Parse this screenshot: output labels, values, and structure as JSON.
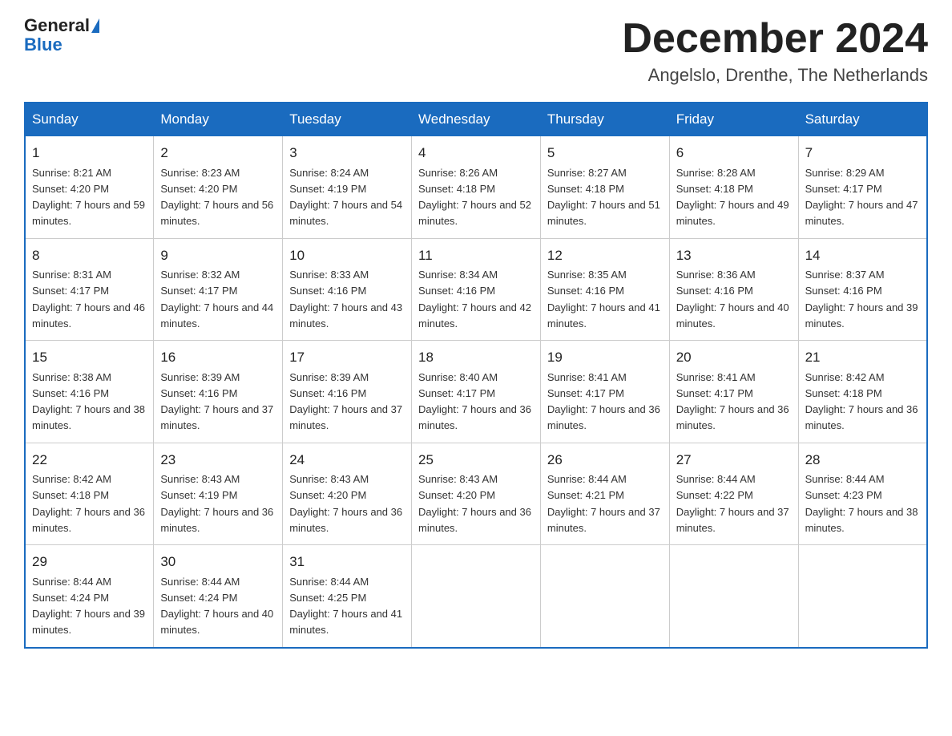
{
  "header": {
    "logo_general": "General",
    "logo_blue": "Blue",
    "title": "December 2024",
    "subtitle": "Angelslo, Drenthe, The Netherlands"
  },
  "days_of_week": [
    "Sunday",
    "Monday",
    "Tuesday",
    "Wednesday",
    "Thursday",
    "Friday",
    "Saturday"
  ],
  "weeks": [
    [
      {
        "date": "1",
        "sunrise": "8:21 AM",
        "sunset": "4:20 PM",
        "daylight": "7 hours and 59 minutes."
      },
      {
        "date": "2",
        "sunrise": "8:23 AM",
        "sunset": "4:20 PM",
        "daylight": "7 hours and 56 minutes."
      },
      {
        "date": "3",
        "sunrise": "8:24 AM",
        "sunset": "4:19 PM",
        "daylight": "7 hours and 54 minutes."
      },
      {
        "date": "4",
        "sunrise": "8:26 AM",
        "sunset": "4:18 PM",
        "daylight": "7 hours and 52 minutes."
      },
      {
        "date": "5",
        "sunrise": "8:27 AM",
        "sunset": "4:18 PM",
        "daylight": "7 hours and 51 minutes."
      },
      {
        "date": "6",
        "sunrise": "8:28 AM",
        "sunset": "4:18 PM",
        "daylight": "7 hours and 49 minutes."
      },
      {
        "date": "7",
        "sunrise": "8:29 AM",
        "sunset": "4:17 PM",
        "daylight": "7 hours and 47 minutes."
      }
    ],
    [
      {
        "date": "8",
        "sunrise": "8:31 AM",
        "sunset": "4:17 PM",
        "daylight": "7 hours and 46 minutes."
      },
      {
        "date": "9",
        "sunrise": "8:32 AM",
        "sunset": "4:17 PM",
        "daylight": "7 hours and 44 minutes."
      },
      {
        "date": "10",
        "sunrise": "8:33 AM",
        "sunset": "4:16 PM",
        "daylight": "7 hours and 43 minutes."
      },
      {
        "date": "11",
        "sunrise": "8:34 AM",
        "sunset": "4:16 PM",
        "daylight": "7 hours and 42 minutes."
      },
      {
        "date": "12",
        "sunrise": "8:35 AM",
        "sunset": "4:16 PM",
        "daylight": "7 hours and 41 minutes."
      },
      {
        "date": "13",
        "sunrise": "8:36 AM",
        "sunset": "4:16 PM",
        "daylight": "7 hours and 40 minutes."
      },
      {
        "date": "14",
        "sunrise": "8:37 AM",
        "sunset": "4:16 PM",
        "daylight": "7 hours and 39 minutes."
      }
    ],
    [
      {
        "date": "15",
        "sunrise": "8:38 AM",
        "sunset": "4:16 PM",
        "daylight": "7 hours and 38 minutes."
      },
      {
        "date": "16",
        "sunrise": "8:39 AM",
        "sunset": "4:16 PM",
        "daylight": "7 hours and 37 minutes."
      },
      {
        "date": "17",
        "sunrise": "8:39 AM",
        "sunset": "4:16 PM",
        "daylight": "7 hours and 37 minutes."
      },
      {
        "date": "18",
        "sunrise": "8:40 AM",
        "sunset": "4:17 PM",
        "daylight": "7 hours and 36 minutes."
      },
      {
        "date": "19",
        "sunrise": "8:41 AM",
        "sunset": "4:17 PM",
        "daylight": "7 hours and 36 minutes."
      },
      {
        "date": "20",
        "sunrise": "8:41 AM",
        "sunset": "4:17 PM",
        "daylight": "7 hours and 36 minutes."
      },
      {
        "date": "21",
        "sunrise": "8:42 AM",
        "sunset": "4:18 PM",
        "daylight": "7 hours and 36 minutes."
      }
    ],
    [
      {
        "date": "22",
        "sunrise": "8:42 AM",
        "sunset": "4:18 PM",
        "daylight": "7 hours and 36 minutes."
      },
      {
        "date": "23",
        "sunrise": "8:43 AM",
        "sunset": "4:19 PM",
        "daylight": "7 hours and 36 minutes."
      },
      {
        "date": "24",
        "sunrise": "8:43 AM",
        "sunset": "4:20 PM",
        "daylight": "7 hours and 36 minutes."
      },
      {
        "date": "25",
        "sunrise": "8:43 AM",
        "sunset": "4:20 PM",
        "daylight": "7 hours and 36 minutes."
      },
      {
        "date": "26",
        "sunrise": "8:44 AM",
        "sunset": "4:21 PM",
        "daylight": "7 hours and 37 minutes."
      },
      {
        "date": "27",
        "sunrise": "8:44 AM",
        "sunset": "4:22 PM",
        "daylight": "7 hours and 37 minutes."
      },
      {
        "date": "28",
        "sunrise": "8:44 AM",
        "sunset": "4:23 PM",
        "daylight": "7 hours and 38 minutes."
      }
    ],
    [
      {
        "date": "29",
        "sunrise": "8:44 AM",
        "sunset": "4:24 PM",
        "daylight": "7 hours and 39 minutes."
      },
      {
        "date": "30",
        "sunrise": "8:44 AM",
        "sunset": "4:24 PM",
        "daylight": "7 hours and 40 minutes."
      },
      {
        "date": "31",
        "sunrise": "8:44 AM",
        "sunset": "4:25 PM",
        "daylight": "7 hours and 41 minutes."
      },
      null,
      null,
      null,
      null
    ]
  ]
}
